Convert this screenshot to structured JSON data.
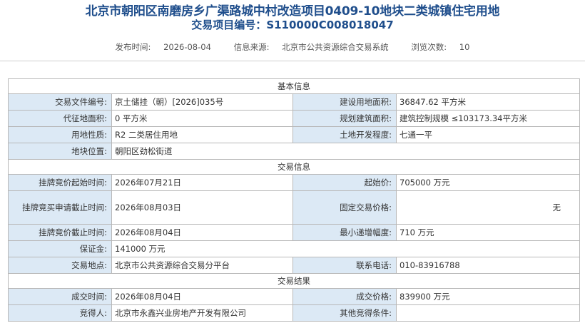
{
  "header": {
    "title": "北京市朝阳区南磨房乡广渠路城中村改造项目0409-10地块二类城镇住宅用地",
    "project_no_label": "交易项目编号：",
    "project_no": "S110000C008018047",
    "publish_label": "发布时间:",
    "publish_date": "2026-08-04",
    "source_label": "信息来源:",
    "source": "北京市公共资源综合交易系统",
    "views_label": "浏览次数:",
    "views": "10"
  },
  "basic": {
    "section": "基本信息",
    "doc_no_label": "交易文件编号:",
    "doc_no": "京土储挂（朝）[2026]035号",
    "build_area_label": "建设用地面积:",
    "build_area": "36847.62 平方米",
    "proxy_area_label": "代征地面积:",
    "proxy_area": "0 平方米",
    "plan_area_label": "规划建筑面积:",
    "plan_area": "建筑控制规模 ≤103173.34平方米",
    "use_label": "用地性质:",
    "use": "R2 二类居住用地",
    "dev_label": "土地开发程度:",
    "dev": "七通一平",
    "location_label": "地块位置:",
    "location": "朝阳区劲松街道"
  },
  "trade": {
    "section": "交易信息",
    "start_label": "挂牌竞价起始时间:",
    "start": "2026年07月21日",
    "start_price_label": "起始价:",
    "start_price": "705000 万元",
    "apply_end_label": "挂牌竞买申请截止时间:",
    "apply_end": "2026年08月03日",
    "fixed_price_label": "固定交易价格:",
    "fixed_price": "无",
    "bid_end_label": "挂牌竞价截止时间:",
    "bid_end": "2026年08月04日",
    "increment_label": "最小递增幅度:",
    "increment": "710 万元",
    "deposit_label": "保证金:",
    "deposit": "141000 万元",
    "venue_label": "交易地点:",
    "venue": "北京市公共资源综合交易分平台",
    "phone_label": "联系电话:",
    "phone": "010-83916788"
  },
  "result": {
    "section": "交易结果",
    "deal_time_label": "成交时间:",
    "deal_time": "2026年08月04日",
    "deal_price_label": "成交价格:",
    "deal_price": "839900 万元",
    "winner_label": "竞得人:",
    "winner": "北京市永鑫兴业房地产开发有限公司",
    "other_label": "其他竞得条件:",
    "other": ""
  }
}
